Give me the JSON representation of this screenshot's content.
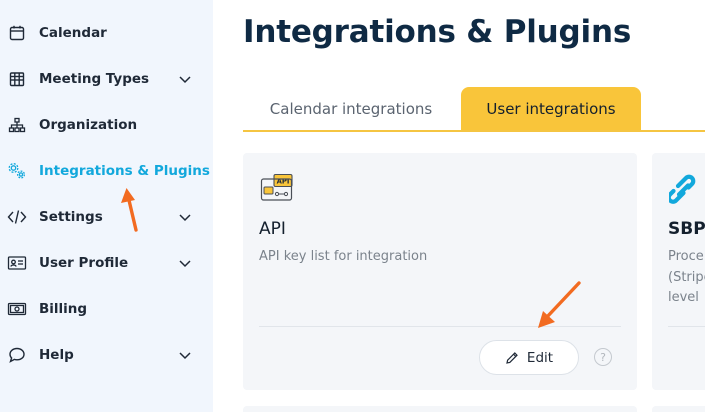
{
  "sidebar": {
    "items": [
      {
        "label": "Calendar",
        "icon": "calendar-icon",
        "chevron": false,
        "active": false
      },
      {
        "label": "Meeting Types",
        "icon": "meeting-types-grid-icon",
        "chevron": true,
        "active": false
      },
      {
        "label": "Organization",
        "icon": "organization-tree-icon",
        "chevron": false,
        "active": false
      },
      {
        "label": "Integrations & Plugins",
        "icon": "gears-icon",
        "chevron": false,
        "active": true
      },
      {
        "label": "Settings",
        "icon": "code-icon",
        "chevron": true,
        "active": false
      },
      {
        "label": "User Profile",
        "icon": "id-card-icon",
        "chevron": true,
        "active": false
      },
      {
        "label": "Billing",
        "icon": "money-bill-icon",
        "chevron": false,
        "active": false
      },
      {
        "label": "Help",
        "icon": "chat-bubble-icon",
        "chevron": true,
        "active": false
      }
    ]
  },
  "main": {
    "title": "Integrations & Plugins",
    "tabs": [
      {
        "label": "Calendar integrations",
        "active": false
      },
      {
        "label": "User integrations",
        "active": true
      }
    ],
    "cards": [
      {
        "icon": "api-icon",
        "icon_text": "API",
        "title": "API",
        "description": "API key list for integration",
        "edit_label": "Edit",
        "help_label": "?"
      },
      {
        "icon": "sbp-logo-icon",
        "title": "SBP",
        "description_lines": [
          "Proce",
          "(Stripe",
          "level"
        ]
      }
    ]
  },
  "colors": {
    "sidebar_bg": "#f1f6fd",
    "active_nav": "#12a8dc",
    "title": "#0f2a44",
    "tab_active_bg": "#f9c53a",
    "tab_underline": "#f5c542",
    "card_bg": "#f4f6f9",
    "annotation_arrow": "#f26b21"
  }
}
